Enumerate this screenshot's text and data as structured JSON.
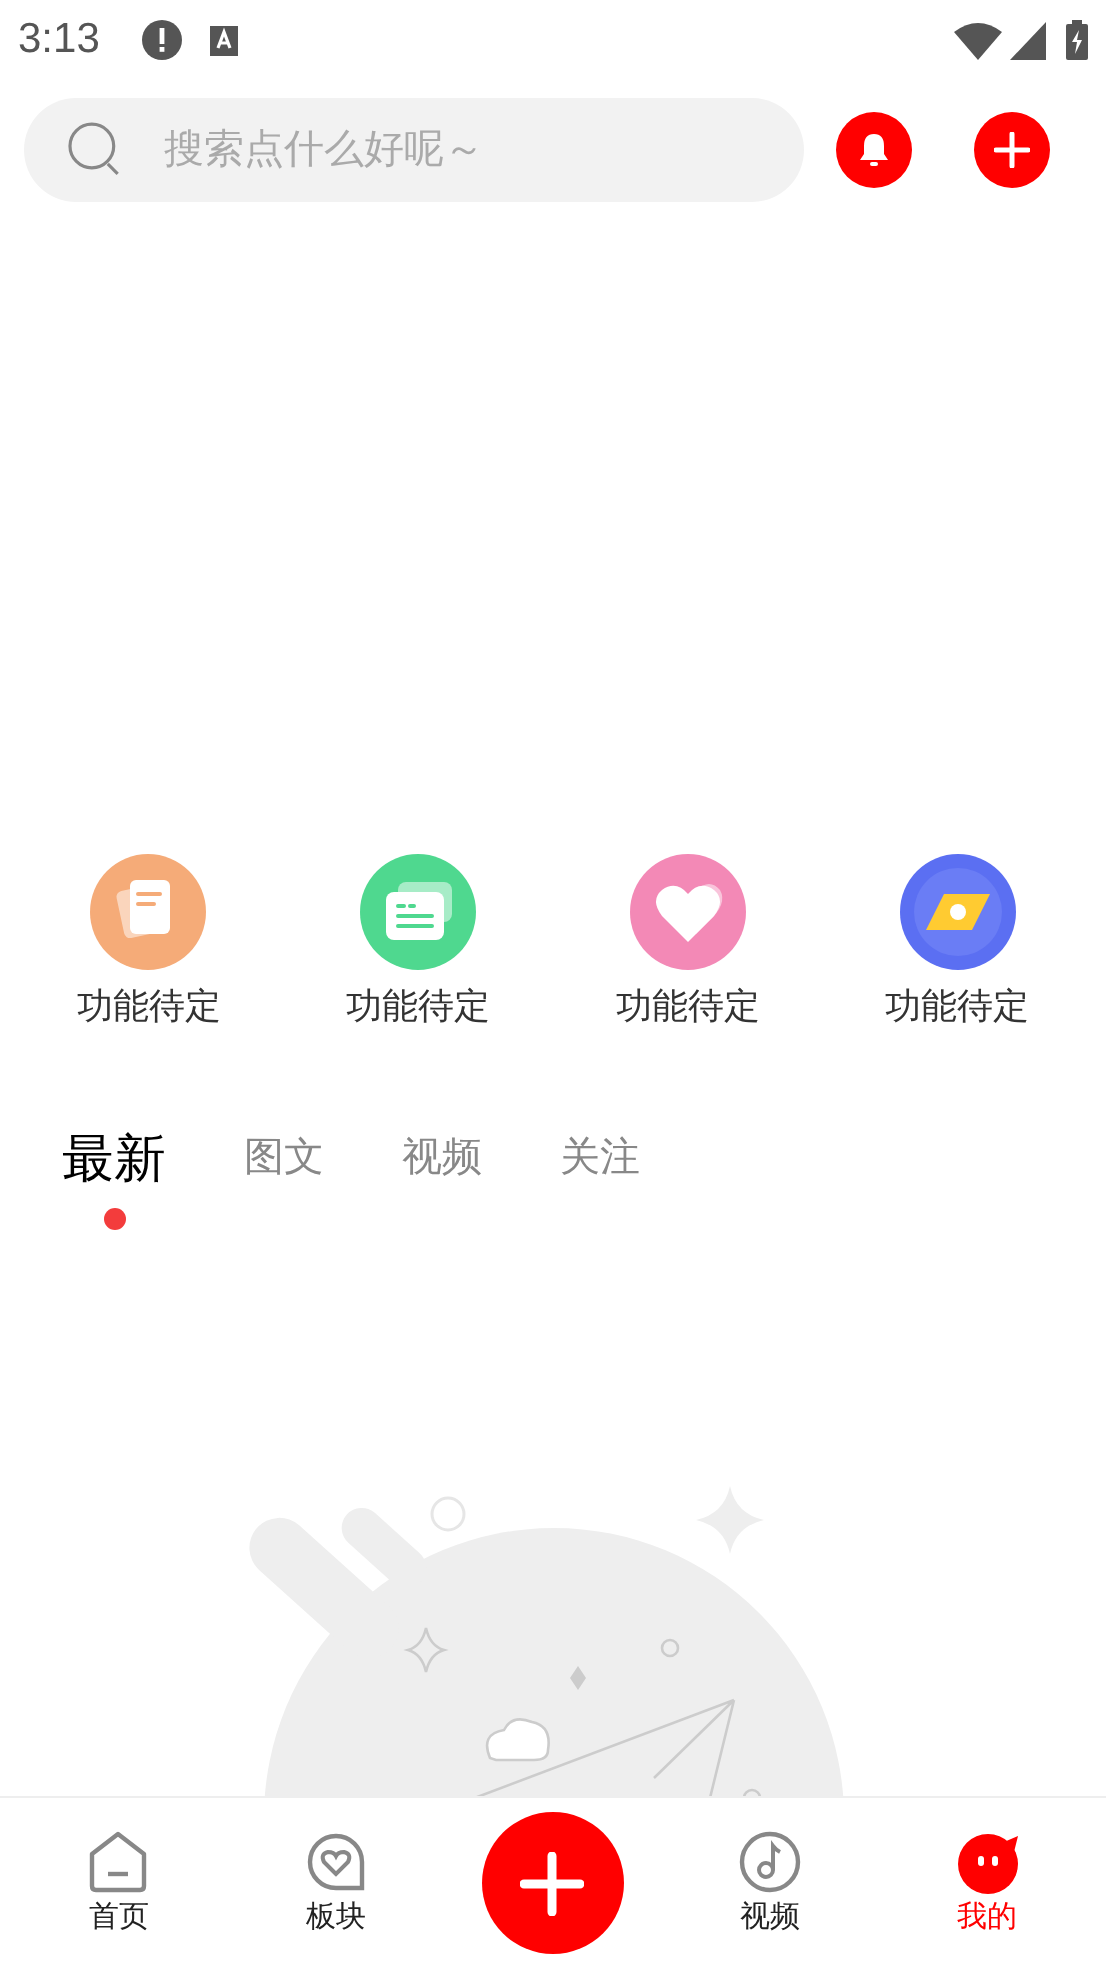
{
  "status_bar": {
    "time": "3:13"
  },
  "search": {
    "placeholder": "搜索点什么好呢～"
  },
  "shortcuts": [
    {
      "label": "功能待定",
      "kind": "document"
    },
    {
      "label": "功能待定",
      "kind": "cards"
    },
    {
      "label": "功能待定",
      "kind": "heart"
    },
    {
      "label": "功能待定",
      "kind": "ticket"
    }
  ],
  "tabs": [
    {
      "label": "最新",
      "selected": true
    },
    {
      "label": "图文",
      "selected": false
    },
    {
      "label": "视频",
      "selected": false
    },
    {
      "label": "关注",
      "selected": false
    }
  ],
  "bottom_nav": [
    {
      "label": "首页",
      "kind": "home",
      "selected": false
    },
    {
      "label": "板块",
      "kind": "board",
      "selected": false
    },
    {
      "kind": "add"
    },
    {
      "label": "视频",
      "kind": "video",
      "selected": false
    },
    {
      "label": "我的",
      "kind": "me",
      "selected": true
    }
  ]
}
